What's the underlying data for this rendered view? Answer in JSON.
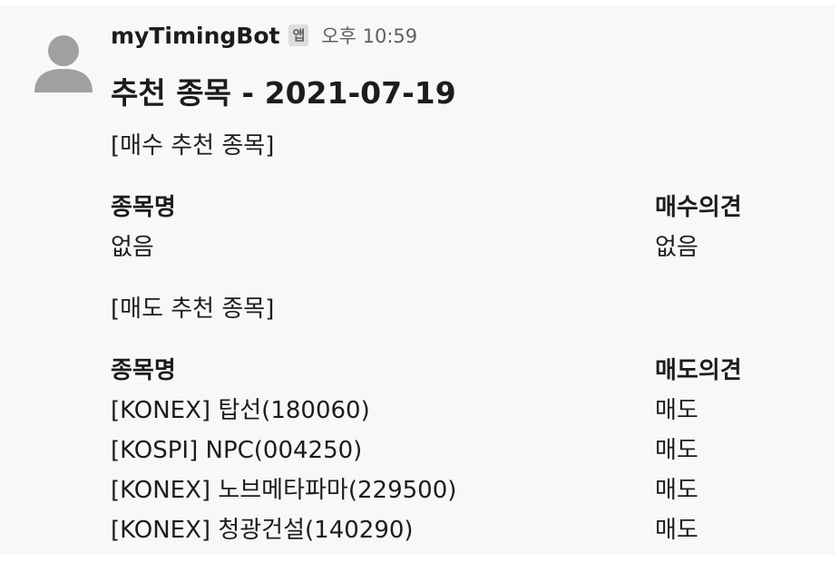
{
  "message": {
    "sender": "myTimingBot",
    "app_badge": "앱",
    "timestamp": "오후 10:59",
    "title": "추천 종목 - 2021-07-19",
    "buy_section": {
      "heading": "[매수 추천 종목]",
      "col_name_header": "종목명",
      "col_opinion_header": "매수의견",
      "rows": [
        {
          "name": "없음",
          "opinion": "없음"
        }
      ]
    },
    "sell_section": {
      "heading": "[매도 추천 종목]",
      "col_name_header": "종목명",
      "col_opinion_header": "매도의견",
      "rows": [
        {
          "name": "[KONEX] 탑선(180060)",
          "opinion": "매도"
        },
        {
          "name": "[KOSPI] NPC(004250)",
          "opinion": "매도"
        },
        {
          "name": "[KONEX] 노브메타파마(229500)",
          "opinion": "매도"
        },
        {
          "name": "[KONEX] 청광건설(140290)",
          "opinion": "매도"
        }
      ]
    }
  },
  "colors": {
    "background": "#f8f8f8",
    "text": "#1d1c1d",
    "muted": "#616061",
    "avatar": "#a0a0a0"
  },
  "icons": {
    "avatar": "default-user-avatar-icon"
  }
}
